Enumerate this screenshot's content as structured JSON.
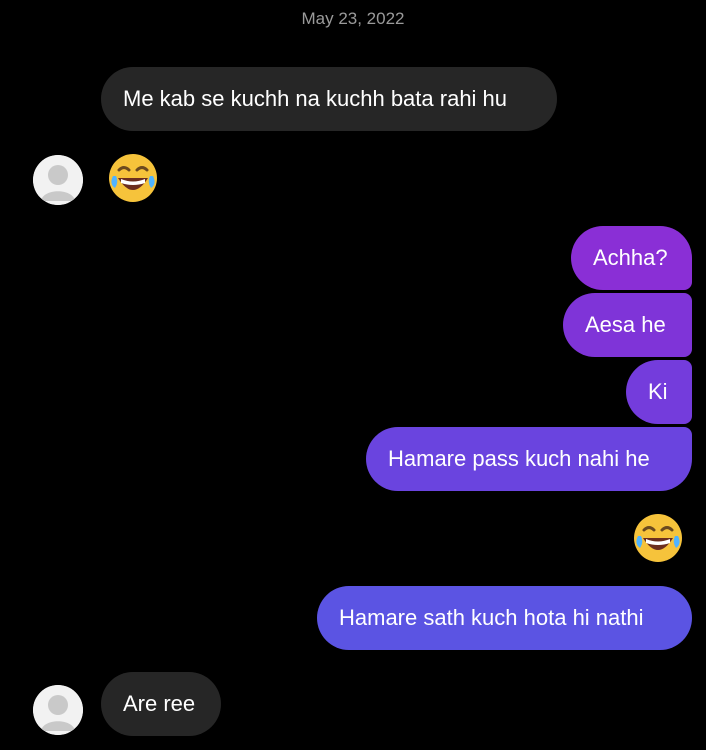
{
  "conversation": {
    "date": "May 23, 2022",
    "messages": [
      {
        "text": "Me kab se kuchh na kuchh bata rahi hu"
      },
      {
        "emoji": "laughing-tears-icon"
      },
      {
        "text": "Achha?"
      },
      {
        "text": "Aesa he"
      },
      {
        "text": "Ki"
      },
      {
        "text": "Hamare pass kuch nahi he"
      },
      {
        "emoji": "laughing-tears-icon"
      },
      {
        "text": "Hamare sath kuch hota hi nathi"
      },
      {
        "text": "Are ree"
      }
    ]
  },
  "colors": {
    "incoming_bubble": "#262626",
    "outgoing_top": "#8a2fd6",
    "outgoing_bottom": "#5b54e3",
    "timestamp": "#9a9a9a"
  }
}
